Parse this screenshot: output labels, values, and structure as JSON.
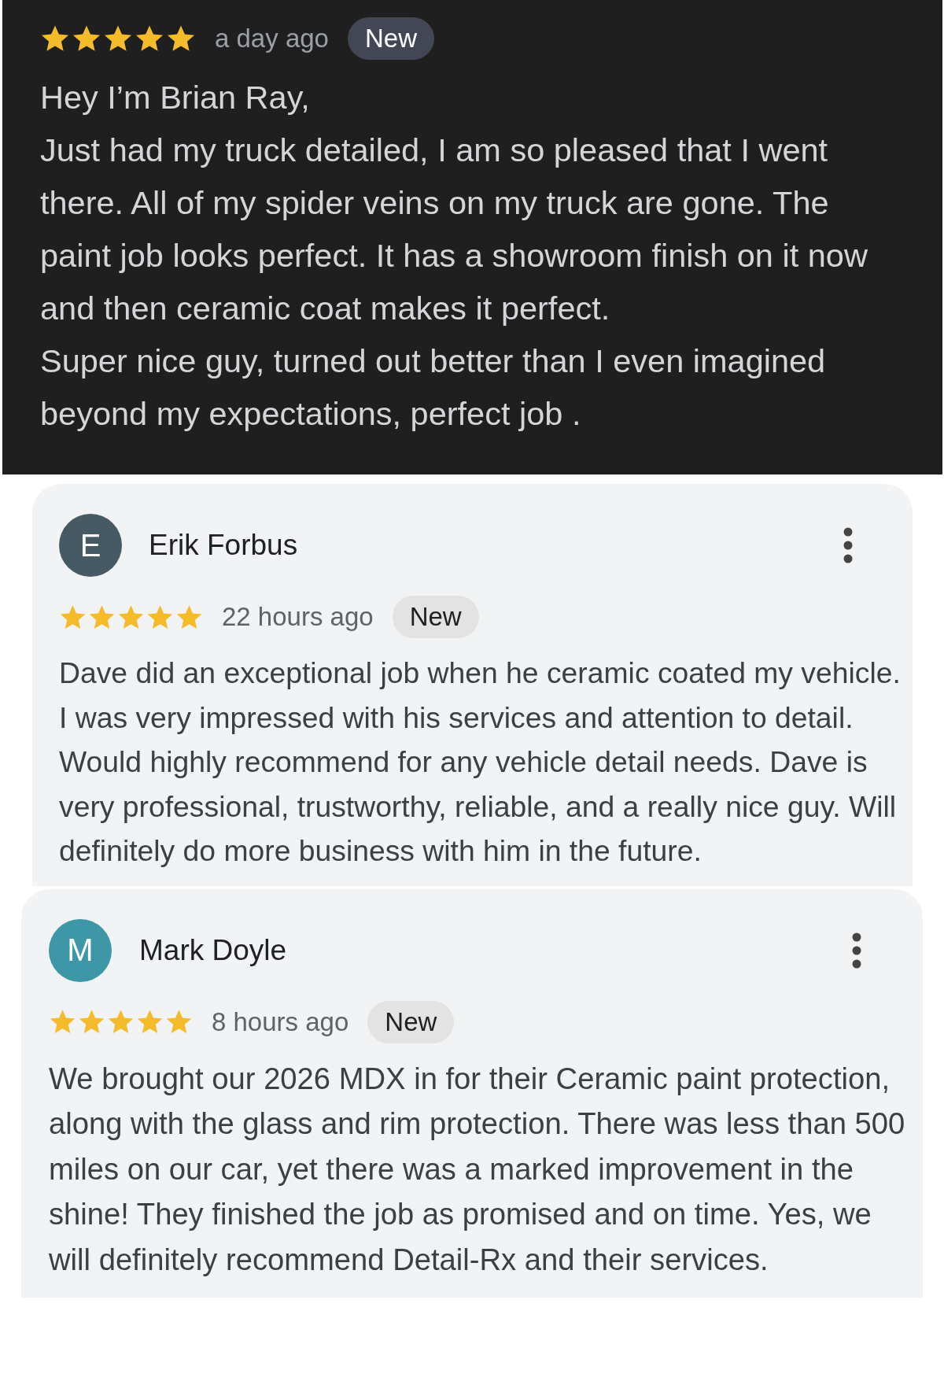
{
  "reviews": [
    {
      "dark": true,
      "stars": 5,
      "time": "a day ago",
      "badge": "New",
      "paragraphs": [
        "Hey I’m Brian Ray,",
        "Just had my truck detailed, I am so pleased that I went there. All of my spider veins on my truck are gone. The paint job looks perfect. It has a showroom finish on it now and then ceramic coat makes it perfect.",
        "Super nice guy, turned out better than I even imagined beyond my expectations, perfect job ."
      ]
    },
    {
      "dark": false,
      "author": {
        "initial": "E",
        "name": "Erik Forbus",
        "color": "#455a64"
      },
      "stars": 5,
      "time": "22 hours ago",
      "badge": "New",
      "paragraphs": [
        "Dave did an exceptional job when he ceramic coated my vehicle. I was very impressed with his services and attention to detail. Would highly recommend for any vehicle detail needs. Dave is very professional, trustworthy, reliable, and a really nice guy. Will definitely do more business with him in the future."
      ]
    },
    {
      "dark": false,
      "author": {
        "initial": "M",
        "name": "Mark Doyle",
        "color": "#3d97a6"
      },
      "stars": 5,
      "time": "8 hours ago",
      "badge": "New",
      "paragraphs": [
        "We brought our 2026 MDX in for their Ceramic paint protection, along with the glass and rim protection. There was less than 500 miles on our car, yet there was a marked improvement in the shine! They finished the job as promised and on time. Yes, we will definitely recommend Detail-Rx and their services."
      ]
    }
  ]
}
